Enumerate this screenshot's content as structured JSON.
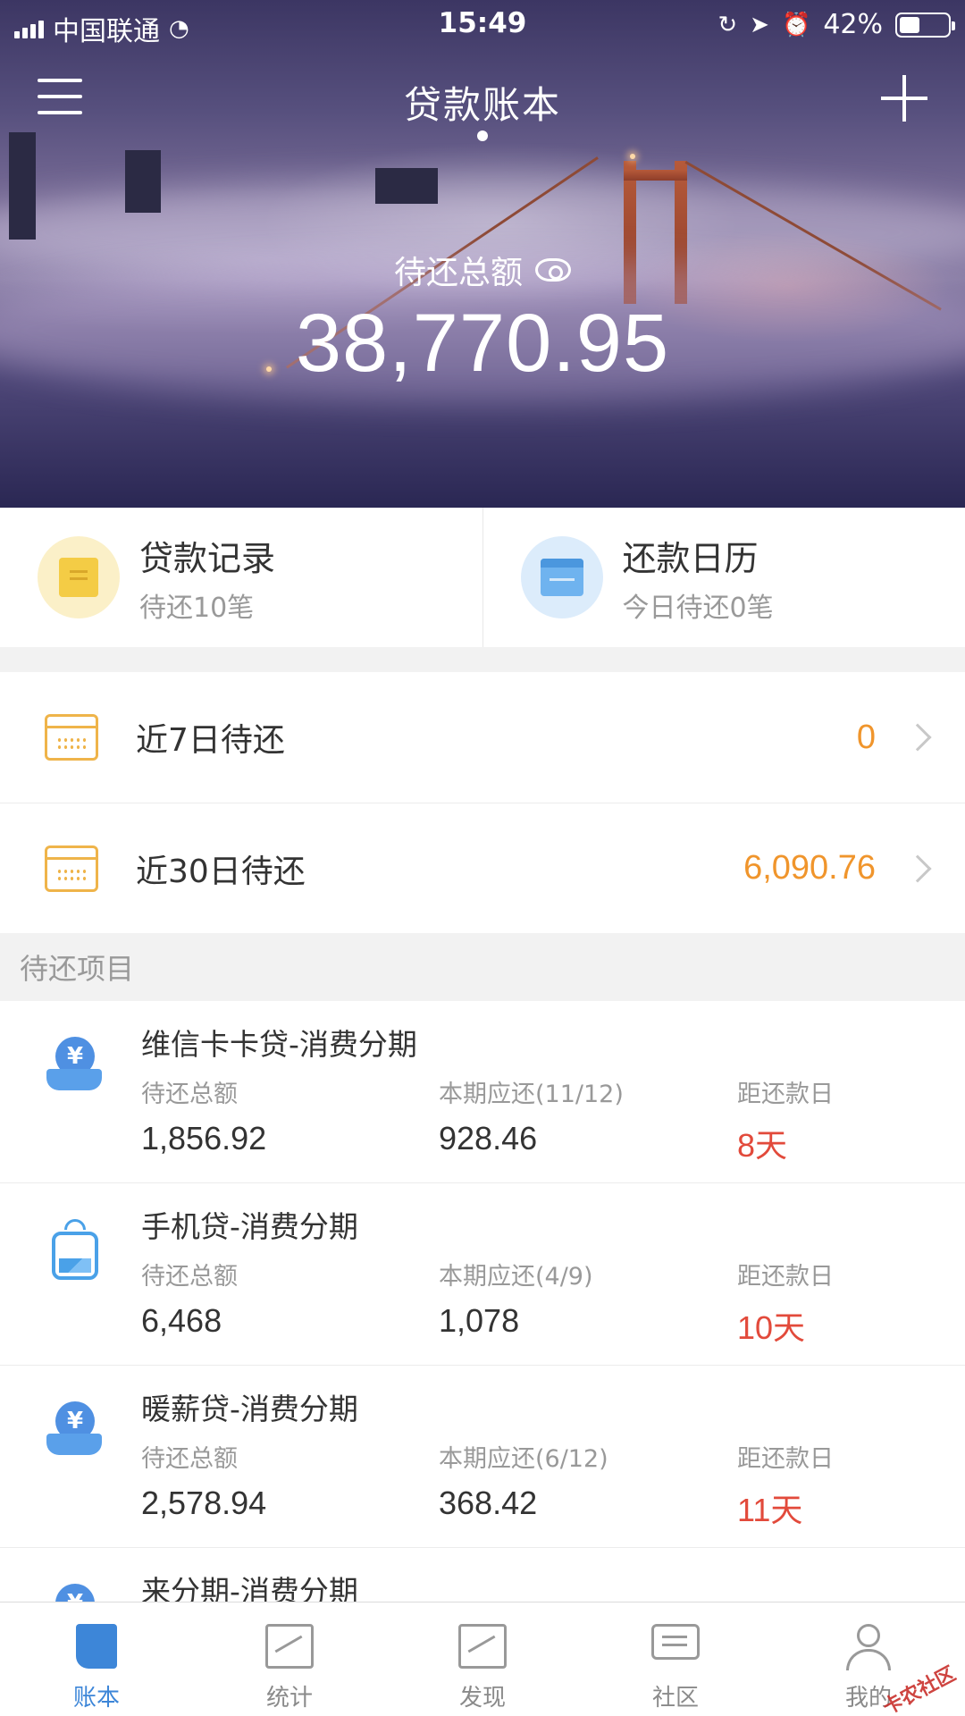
{
  "status_bar": {
    "carrier": "中国联通",
    "time": "15:49",
    "battery": "42%",
    "battery_level": 0.42
  },
  "header": {
    "title": "贷款账本",
    "total_label": "待还总额",
    "total_amount": "38,770.95"
  },
  "quick_links": [
    {
      "title": "贷款记录",
      "subtitle": "待还10笔",
      "icon": "note-icon"
    },
    {
      "title": "还款日历",
      "subtitle": "今日待还0笔",
      "icon": "calendar-icon"
    }
  ],
  "summary": [
    {
      "label": "近7日待还",
      "value": "0"
    },
    {
      "label": "近30日待还",
      "value": "6,090.76"
    }
  ],
  "pending_section": {
    "title": "待还项目"
  },
  "pending_items": [
    {
      "name": "维信卡卡贷-消费分期",
      "icon": "yen-hand-icon",
      "col1_label": "待还总额",
      "col1_value": "1,856.92",
      "col2_label": "本期应还(11/12)",
      "col2_value": "928.46",
      "col3_label": "距还款日",
      "col3_value": "8天"
    },
    {
      "name": "手机贷-消费分期",
      "icon": "phone-icon",
      "col1_label": "待还总额",
      "col1_value": "6,468",
      "col2_label": "本期应还(4/9)",
      "col2_value": "1,078",
      "col3_label": "距还款日",
      "col3_value": "10天"
    },
    {
      "name": "暖薪贷-消费分期",
      "icon": "yen-hand-icon",
      "col1_label": "待还总额",
      "col1_value": "2,578.94",
      "col2_label": "本期应还(6/12)",
      "col2_value": "368.42",
      "col3_label": "距还款日",
      "col3_value": "11天"
    },
    {
      "name": "来分期-消费分期",
      "icon": "yen-hand-icon"
    }
  ],
  "tabs": [
    {
      "label": "账本",
      "active": true,
      "icon": "ledger-icon"
    },
    {
      "label": "统计",
      "icon": "chart-icon"
    },
    {
      "label": "发现",
      "icon": "discover-icon"
    },
    {
      "label": "社区",
      "icon": "chat-icon"
    },
    {
      "label": "我的",
      "icon": "user-icon"
    }
  ],
  "watermark": "卡农社区",
  "colors": {
    "accent": "#3d86d8",
    "orange": "#f0952c",
    "red": "#e24a3b"
  }
}
